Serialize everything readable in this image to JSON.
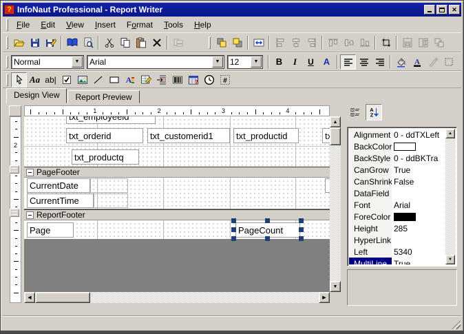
{
  "window": {
    "title": "InfoNaut Professional - Report Writer",
    "app_icon_glyph": "?",
    "controls": [
      {
        "id": "minimize",
        "label": "minimize"
      },
      {
        "id": "maximize",
        "label": "maximize"
      },
      {
        "id": "close",
        "label": "close"
      }
    ]
  },
  "colors": {
    "titlebar": "#0d1a9a",
    "face": "#d4d0c8",
    "selection": "#000080",
    "canvas_void": "#808080",
    "selection_handle": "#1e3f77"
  },
  "menu": {
    "items": [
      {
        "label": "File",
        "underline": 0
      },
      {
        "label": "Edit",
        "underline": 0
      },
      {
        "label": "View",
        "underline": 0
      },
      {
        "label": "Insert",
        "underline": 0
      },
      {
        "label": "Format",
        "underline": 1
      },
      {
        "label": "Tools",
        "underline": 0
      },
      {
        "label": "Help",
        "underline": 0
      }
    ]
  },
  "toolbar_main": {
    "items": [
      {
        "type": "grip"
      },
      {
        "type": "button",
        "name": "open",
        "icon": "open"
      },
      {
        "type": "button",
        "name": "save",
        "icon": "save"
      },
      {
        "type": "button",
        "name": "save-as",
        "icon": "saveas"
      },
      {
        "type": "sep"
      },
      {
        "type": "button",
        "name": "data-source",
        "icon": "book"
      },
      {
        "type": "button",
        "name": "print-preview",
        "icon": "preview"
      },
      {
        "type": "sep"
      },
      {
        "type": "button",
        "name": "cut",
        "icon": "cut"
      },
      {
        "type": "button",
        "name": "copy",
        "icon": "copy"
      },
      {
        "type": "button",
        "name": "paste",
        "icon": "paste"
      },
      {
        "type": "button",
        "name": "delete",
        "icon": "delete"
      },
      {
        "type": "sep"
      },
      {
        "type": "button",
        "name": "reorder",
        "icon": "stack",
        "disabled": true
      },
      {
        "type": "gap"
      },
      {
        "type": "grip"
      },
      {
        "type": "button",
        "name": "bring-to-front",
        "icon": "front"
      },
      {
        "type": "button",
        "name": "send-to-back",
        "icon": "back"
      },
      {
        "type": "sep"
      },
      {
        "type": "button",
        "name": "center-in-section",
        "icon": "fitwidth"
      },
      {
        "type": "sep"
      },
      {
        "type": "button",
        "name": "align-lefts",
        "icon": "alleft",
        "disabled": true
      },
      {
        "type": "button",
        "name": "align-centers",
        "icon": "alcenter",
        "disabled": true
      },
      {
        "type": "button",
        "name": "align-rights",
        "icon": "alright",
        "disabled": true
      },
      {
        "type": "sep"
      },
      {
        "type": "button",
        "name": "align-tops",
        "icon": "altop",
        "disabled": true
      },
      {
        "type": "button",
        "name": "align-middles",
        "icon": "almiddle",
        "disabled": true
      },
      {
        "type": "button",
        "name": "align-bottoms",
        "icon": "albottom",
        "disabled": true
      },
      {
        "type": "sep"
      },
      {
        "type": "button",
        "name": "snap-to-grid",
        "icon": "snap"
      },
      {
        "type": "sep"
      },
      {
        "type": "button",
        "name": "make-same-width",
        "icon": "samew",
        "disabled": true
      },
      {
        "type": "button",
        "name": "make-same-height",
        "icon": "sameh",
        "disabled": true
      },
      {
        "type": "button",
        "name": "make-same-size",
        "icon": "samesize",
        "disabled": true
      }
    ]
  },
  "toolbar_format": {
    "style_combo": {
      "value": "Normal"
    },
    "font_combo": {
      "value": "Arial"
    },
    "size_combo": {
      "value": "12"
    },
    "items": [
      {
        "type": "button",
        "name": "bold",
        "glyph": "B",
        "cls": "glyphB"
      },
      {
        "type": "button",
        "name": "italic",
        "glyph": "I",
        "cls": "glyphI"
      },
      {
        "type": "button",
        "name": "underline",
        "glyph": "U",
        "cls": "glyphU"
      },
      {
        "type": "button",
        "name": "font-style",
        "glyph": "A",
        "cls": "glyphA"
      },
      {
        "type": "sep"
      },
      {
        "type": "button",
        "name": "align-left",
        "icon": "alignL",
        "pressed": true
      },
      {
        "type": "button",
        "name": "align-center",
        "icon": "alignC"
      },
      {
        "type": "button",
        "name": "align-right",
        "icon": "alignR"
      },
      {
        "type": "sep"
      },
      {
        "type": "button",
        "name": "fill-color",
        "icon": "bucket"
      },
      {
        "type": "button",
        "name": "font-color",
        "icon": "fontcolor"
      },
      {
        "type": "button",
        "name": "format-painter",
        "icon": "painter",
        "disabled": true
      },
      {
        "type": "button",
        "name": "borders",
        "icon": "borders"
      }
    ]
  },
  "toolbox": {
    "items": [
      {
        "name": "pointer-tool",
        "icon": "pointer",
        "pressed": true
      },
      {
        "name": "label-tool",
        "glyph": "Aa",
        "cls": "glyphI"
      },
      {
        "name": "textbox-tool",
        "glyph": "ab|"
      },
      {
        "name": "checkbox-tool",
        "icon": "checkbox"
      },
      {
        "name": "image-tool",
        "icon": "image"
      },
      {
        "name": "line-tool",
        "icon": "line"
      },
      {
        "name": "shape-tool",
        "icon": "shape"
      },
      {
        "name": "richtext-tool",
        "icon": "richtext"
      },
      {
        "name": "subreport-tool",
        "icon": "subreport"
      },
      {
        "name": "pagebreak-tool",
        "icon": "pagebreak"
      },
      {
        "name": "barcode-tool",
        "icon": "barcode"
      },
      {
        "name": "calendar-tool",
        "icon": "calendar"
      },
      {
        "name": "clock-tool",
        "icon": "clock"
      },
      {
        "name": "field-tool",
        "glyph": "#",
        "cls": "glyphB",
        "icon": "numfield"
      }
    ]
  },
  "tabs": [
    {
      "label": "Design View",
      "active": true
    },
    {
      "label": "Report Preview",
      "active": false
    }
  ],
  "ruler": {
    "h_numbers": [
      "1",
      "2",
      "3",
      "4"
    ],
    "v_number": "2"
  },
  "report": {
    "detail_fields": [
      {
        "id": "clip_top",
        "text": "txt_employeeid"
      },
      {
        "id": "orderid",
        "text": "txt_orderid"
      },
      {
        "id": "customerid1",
        "text": "txt_customerid1"
      },
      {
        "id": "productid",
        "text": "txt_productid"
      },
      {
        "id": "orderd",
        "text": "txt_orderd"
      },
      {
        "id": "productq",
        "text": "txt_productq"
      }
    ],
    "bands": [
      {
        "name": "PageFooter"
      },
      {
        "name": "ReportFooter"
      }
    ],
    "pagefooter_fields": [
      {
        "id": "currentdate",
        "text": "CurrentDate"
      },
      {
        "id": "cd_box",
        "text": ""
      },
      {
        "id": "edge_sliver",
        "text": ""
      },
      {
        "id": "currenttime",
        "text": "CurrentTime"
      },
      {
        "id": "ct_box",
        "text": ""
      }
    ],
    "reportfooter_fields": [
      {
        "id": "page",
        "text": "Page"
      },
      {
        "id": "pagecount",
        "text": "PageCount",
        "selected": true
      }
    ]
  },
  "properties": {
    "toolbar": [
      {
        "name": "categorized",
        "icon": "categorized"
      },
      {
        "name": "alphabetic-sort",
        "icon": "sortaz",
        "pressed": true
      }
    ],
    "items": [
      {
        "name": "Alignment",
        "value": "0 - ddTXLeft"
      },
      {
        "name": "BackColor",
        "value": "",
        "swatch": "#ffffff"
      },
      {
        "name": "BackStyle",
        "value": "0 - ddBKTra"
      },
      {
        "name": "CanGrow",
        "value": "True"
      },
      {
        "name": "CanShrink",
        "value": "False"
      },
      {
        "name": "DataField",
        "value": ""
      },
      {
        "name": "Font",
        "value": "Arial"
      },
      {
        "name": "ForeColor",
        "value": "",
        "swatch": "#000000"
      },
      {
        "name": "Height",
        "value": "285"
      },
      {
        "name": "HyperLink",
        "value": ""
      },
      {
        "name": "Left",
        "value": "5340"
      },
      {
        "name": "MultiLine",
        "value": "True",
        "selected": true
      }
    ]
  },
  "statusbar": {
    "text": ""
  }
}
